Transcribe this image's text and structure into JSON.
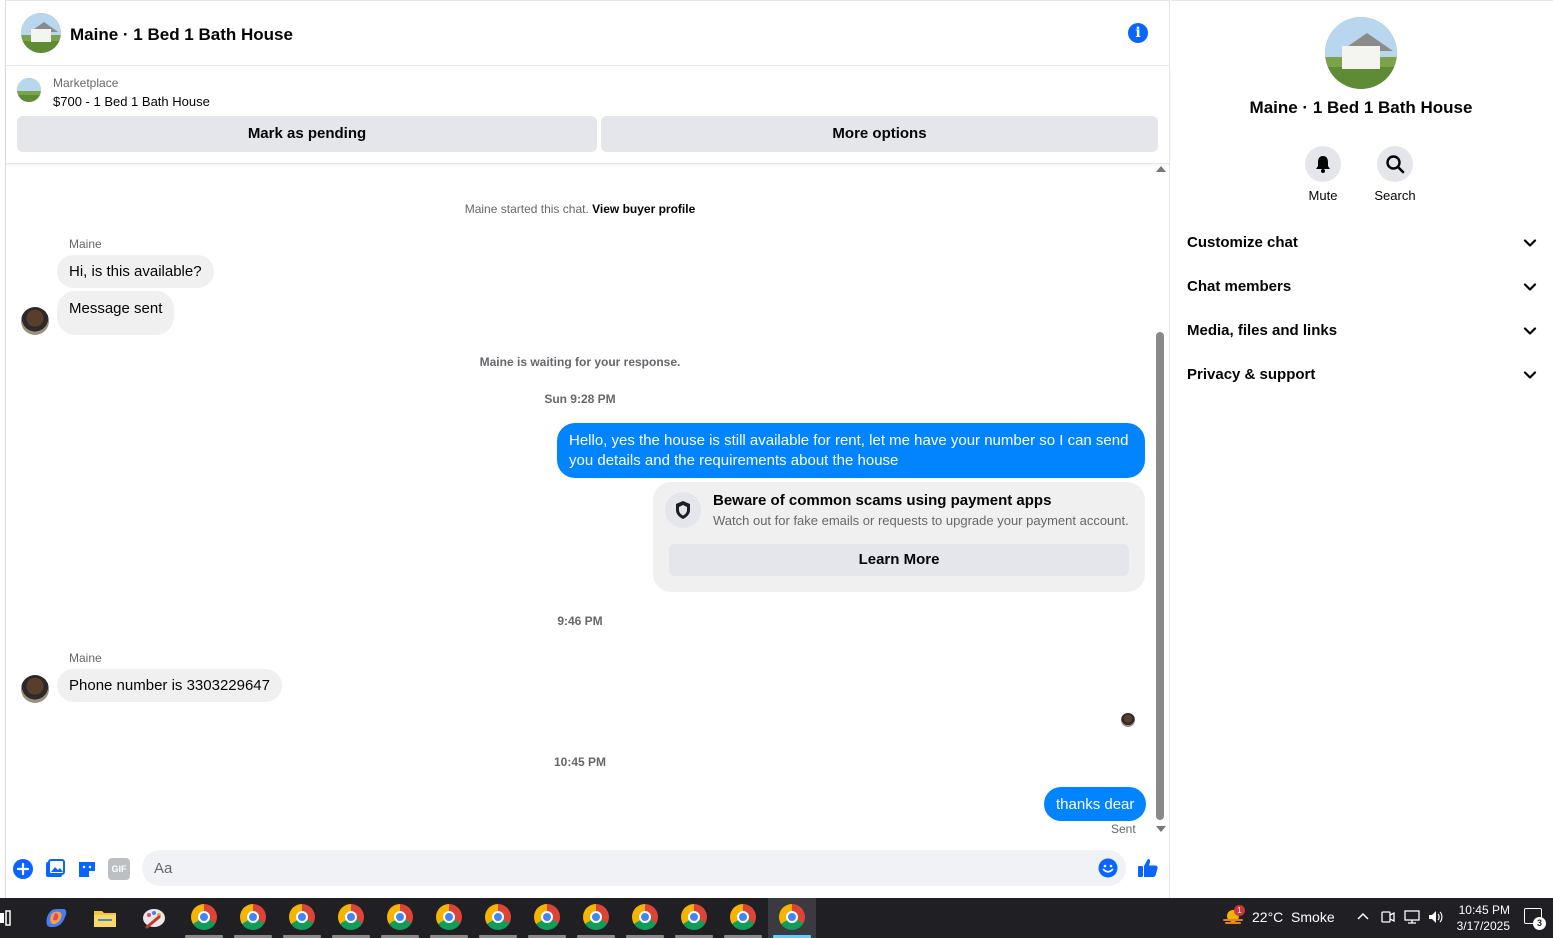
{
  "header": {
    "title": "Maine · 1 Bed 1 Bath House",
    "info_icon": "i"
  },
  "marketplace": {
    "label": "Marketplace",
    "item": "$700 - 1 Bed 1 Bath House",
    "mark_pending_label": "Mark as pending",
    "more_options_label": "More options"
  },
  "conversation": {
    "started_prefix": "Maine started this chat.",
    "view_buyer_profile": "View buyer profile",
    "waiting_notice": "Maine is waiting for your response.",
    "messages": [
      {
        "sender": "Maine",
        "text": "Hi, is this available?"
      },
      {
        "sender": "Maine",
        "text": "Message sent"
      },
      {
        "time": "Sun 9:28 PM"
      },
      {
        "sender": "me",
        "text": "Hello, yes the house is still available for rent, let me have your number so I can send you details and the requirements about the house"
      },
      {
        "time": "9:46 PM"
      },
      {
        "sender": "Maine",
        "text": "Phone number is 3303229647"
      },
      {
        "time": "10:45 PM"
      },
      {
        "sender": "me",
        "text": "thanks dear",
        "status": "Sent"
      }
    ],
    "scam_card": {
      "title": "Beware of common scams using payment apps",
      "description": "Watch out for fake emails or requests to upgrade your payment account.",
      "button": "Learn More"
    }
  },
  "composer": {
    "placeholder": "Aa",
    "gif_label": "GIF"
  },
  "side_panel": {
    "title": "Maine · 1 Bed 1 Bath House",
    "mute_label": "Mute",
    "search_label": "Search",
    "sections": [
      "Customize chat",
      "Chat members",
      "Media, files and links",
      "Privacy & support"
    ]
  },
  "taskbar": {
    "weather": "22°C  Smoke",
    "weather_badge": "1",
    "time": "10:45 PM",
    "date": "3/17/2025",
    "notification_count": "3"
  },
  "colors": {
    "outgoing_bubble": "#0084ff",
    "incoming_bubble": "#f0f0f0",
    "accent": "#0866ff",
    "button_gray": "#e4e6eb"
  },
  "icons": [
    "info-icon",
    "shield-icon",
    "plus-icon",
    "photo-icon",
    "sticker-icon",
    "gif-icon",
    "emoji-icon",
    "like-icon",
    "bell-icon",
    "search-icon",
    "chevron-down-icon"
  ]
}
